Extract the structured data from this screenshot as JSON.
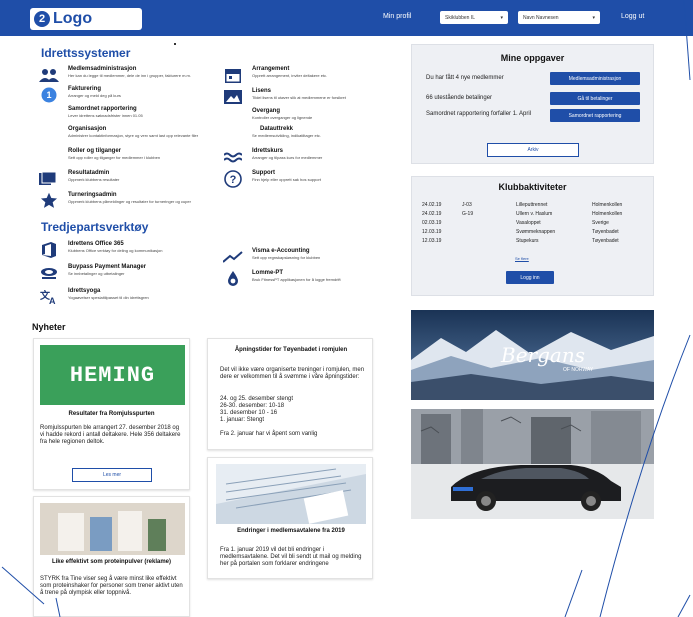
{
  "header": {
    "logo_mark": "2",
    "logo_text": "Logo",
    "my_profile": "Min profil",
    "club_select": "Skiklubben IL",
    "name_select": "Navn Navnesen",
    "logout": "Logg ut",
    "bar_color": "#1f4ea8"
  },
  "idrettssystemer": {
    "title": "Idrettssystemer",
    "left": [
      {
        "icon": "people-icon",
        "title": "Medlemsadministrasjon",
        "desc": "Her kan du legge til medlemmer, dele de inn i grupper, fakturere m.m."
      },
      {
        "icon": "number-one-icon",
        "title": "Fakturering",
        "desc": "Arranger og meld deg på kurs"
      },
      {
        "icon": "",
        "title": "Samordnet rapportering",
        "desc": "Lever idrettens søknadsfrister innen 01.05"
      },
      {
        "icon": "",
        "title": "Organisasjon",
        "desc": "Administrer kontaktinformasjon, styre og verv samt last opp relevante filer"
      },
      {
        "icon": "",
        "title": "Roller og tilganger",
        "desc": "Sett opp roller og tilganger for medlemmer i klubben"
      },
      {
        "icon": "book-icon",
        "title": "Resultatadmin",
        "desc": "Oppmerk klubbens resultater"
      },
      {
        "icon": "star-icon",
        "title": "Turneringsadmin",
        "desc": "Oppmerk klubbens påmeldinger og resultater for turneringer og cuper"
      }
    ],
    "right": [
      {
        "icon": "calendar-icon",
        "title": "Arrangement",
        "desc": "Opprett arrangement, inviter deltakere etc."
      },
      {
        "icon": "image-icon",
        "title": "Lisens",
        "desc": "Tildel lisens til utøver slik at medlemmene er forsikret"
      },
      {
        "icon": "",
        "title": "Overgang",
        "desc": "Kontroller overganger og lignende"
      },
      {
        "icon": "",
        "title": "Datauttrekk",
        "desc": "Se medlemsutvikling, indikatiltager etc."
      },
      {
        "icon": "swim-icon",
        "title": "Idrettskurs",
        "desc": "Arranger og tilpass kurs for medlemmer"
      },
      {
        "icon": "question-icon",
        "title": "Support",
        "desc": "Finn hjelp eller opprett sak hos support"
      }
    ]
  },
  "tredjeparts": {
    "title": "Tredjepartsverktøy",
    "left": [
      {
        "icon": "office-icon",
        "title": "Idrettens Office 365",
        "desc": "Klubbens Office verktøy for deling og kommunikasjon"
      },
      {
        "icon": "buypass-icon",
        "title": "Buypass Payment Manager",
        "desc": "Se innbetalinger og utbetalinger"
      },
      {
        "icon": "translate-icon",
        "title": "Idrettsyoga",
        "desc": "Yogaøvelser spesialtilpasset til din idrettsgren"
      }
    ],
    "right": [
      {
        "icon": "trend-icon",
        "title": "Visma e-Accounting",
        "desc": "Sett opp regnskapsløsning for klubben"
      },
      {
        "icon": "drop-icon",
        "title": "Lomme-PT",
        "desc": "Bruk FitnessPT applikasjonen for å logge fremdrift"
      }
    ]
  },
  "tasks": {
    "title": "Mine oppgaver",
    "items": [
      {
        "text": "Du har fått 4 nye medlemmer",
        "button": "Medlemsadministrasjon"
      },
      {
        "text": "66 utestående betalinger",
        "button": "Gå til betalinger"
      },
      {
        "text": "Samordnet rapportering forfaller 1. April",
        "button": "Samordnet rapportering"
      }
    ],
    "archive_button": "Arkiv"
  },
  "activities": {
    "title": "Klubbaktiviteter",
    "rows": [
      {
        "date": "24.02.19",
        "group": "J-03",
        "event": "Lilleputtrennet",
        "place": "Holmenkollen"
      },
      {
        "date": "24.02.19",
        "group": "G-19",
        "event": "Ullern v. Haslum",
        "place": "Holmenkollen"
      },
      {
        "date": "02.03.19",
        "group": "",
        "event": "Vasaloppet",
        "place": "Sverige"
      },
      {
        "date": "12.03.19",
        "group": "",
        "event": "Svømmeknappen",
        "place": "Tøyenbadet"
      },
      {
        "date": "12.03.19",
        "group": "",
        "event": "Stupekurs",
        "place": "Tøyenbadet"
      }
    ],
    "see_more": "Se flere",
    "login_button": "Logg inn"
  },
  "ads": {
    "bergans_text": "Bergans",
    "bergans_sub": "OF NORWAY"
  },
  "news": {
    "title": "Nyheter",
    "heming_logo": "HEMING",
    "heming_color": "#3aa05a",
    "card1_title": "Resultater fra Romjulsspurten",
    "card1_body": "Romjulsspurten ble arrangert 27. desember 2018 og vi hadde rekord i antall deltakere. Hele 356 deltakere fra hele regionen deltok.",
    "card1_button": "Les mer",
    "card2_title": "Åpningstider for Tøyenbadet i romjulen",
    "card2_body1": "Det vil ikke være organiserte treninger i romjulen, men dere er velkommen til å svømme i våre åpningstider:",
    "card2_hours": [
      "24. og 25. desember stengt",
      "26-30. desember: 10-18",
      "31. desember 10 - 16",
      "1. januar: Stengt"
    ],
    "card2_body2": "Fra 2. januar har vi åpent som vanlig",
    "card3_title": "Endringer i medlemsavtalene fra 2019",
    "card3_body": "Fra 1. januar 2019 vil det bli endringer i medlemsavtalene. Det vil bli sendt ut mail og melding her på portalen som forklarer endringene",
    "card4_title": "Like effektivt som proteinpulver (reklame)",
    "card4_body": "STYRK fra Tine viser seg å være minst like effektivt som proteinshaker for personer som trener aktivt uten å trene på olympisk eller toppnivå."
  }
}
